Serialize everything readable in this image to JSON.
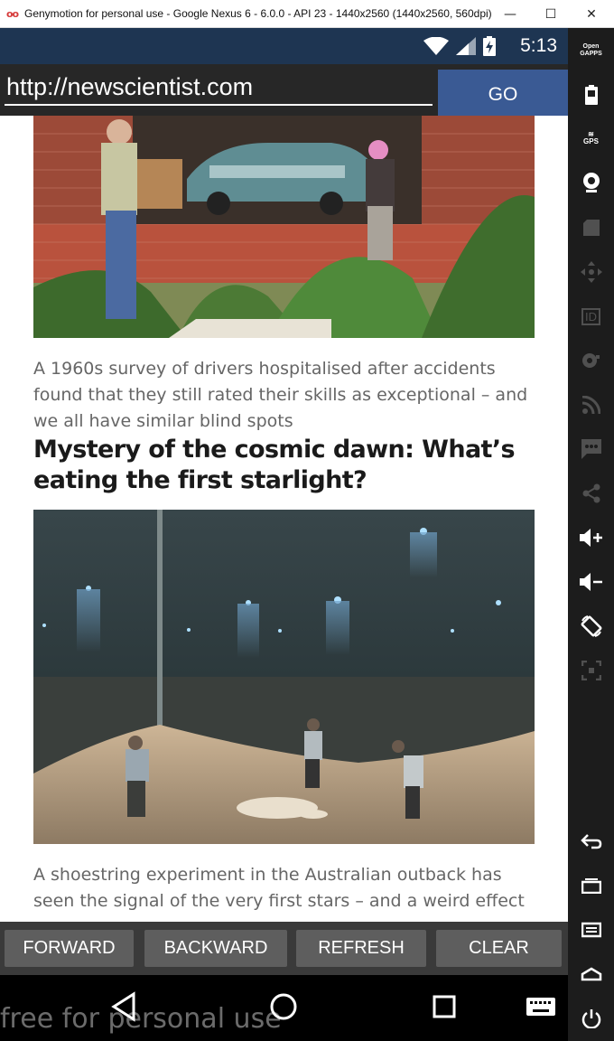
{
  "window": {
    "title": "Genymotion for personal use - Google Nexus 6 - 6.0.0 - API 23 - 1440x2560 (1440x2560, 560dpi) -...",
    "minimize_label": "—",
    "maximize_label": "☐",
    "close_label": "✕"
  },
  "status_bar": {
    "time": "5:13"
  },
  "url_bar": {
    "value": "http://newscientist.com",
    "go_label": "GO"
  },
  "article": {
    "caption_1": "A 1960s survey of drivers hospitalised after accidents found that they still rated their skills as exceptional – and we all have similar blind spots",
    "headline": "Mystery of the cosmic dawn: What’s eating the first starlight?",
    "caption_2": "A shoestring experiment in the Australian outback has seen the signal of the very first stars – and a weird effect"
  },
  "buttons": {
    "forward": "FORWARD",
    "backward": "BACKWARD",
    "refresh": "REFRESH",
    "clear": "CLEAR"
  },
  "genymotion": {
    "open_gapps_line1": "Open",
    "open_gapps_line2": "GAPPS",
    "gps_label": "GPS",
    "id_label": "ID"
  },
  "watermark": "free for personal use",
  "colors": {
    "status_bar": "#1e3552",
    "go_button": "#3a5a94",
    "app_button": "#5e5e5e",
    "toolbar": "#1c1c1c"
  }
}
